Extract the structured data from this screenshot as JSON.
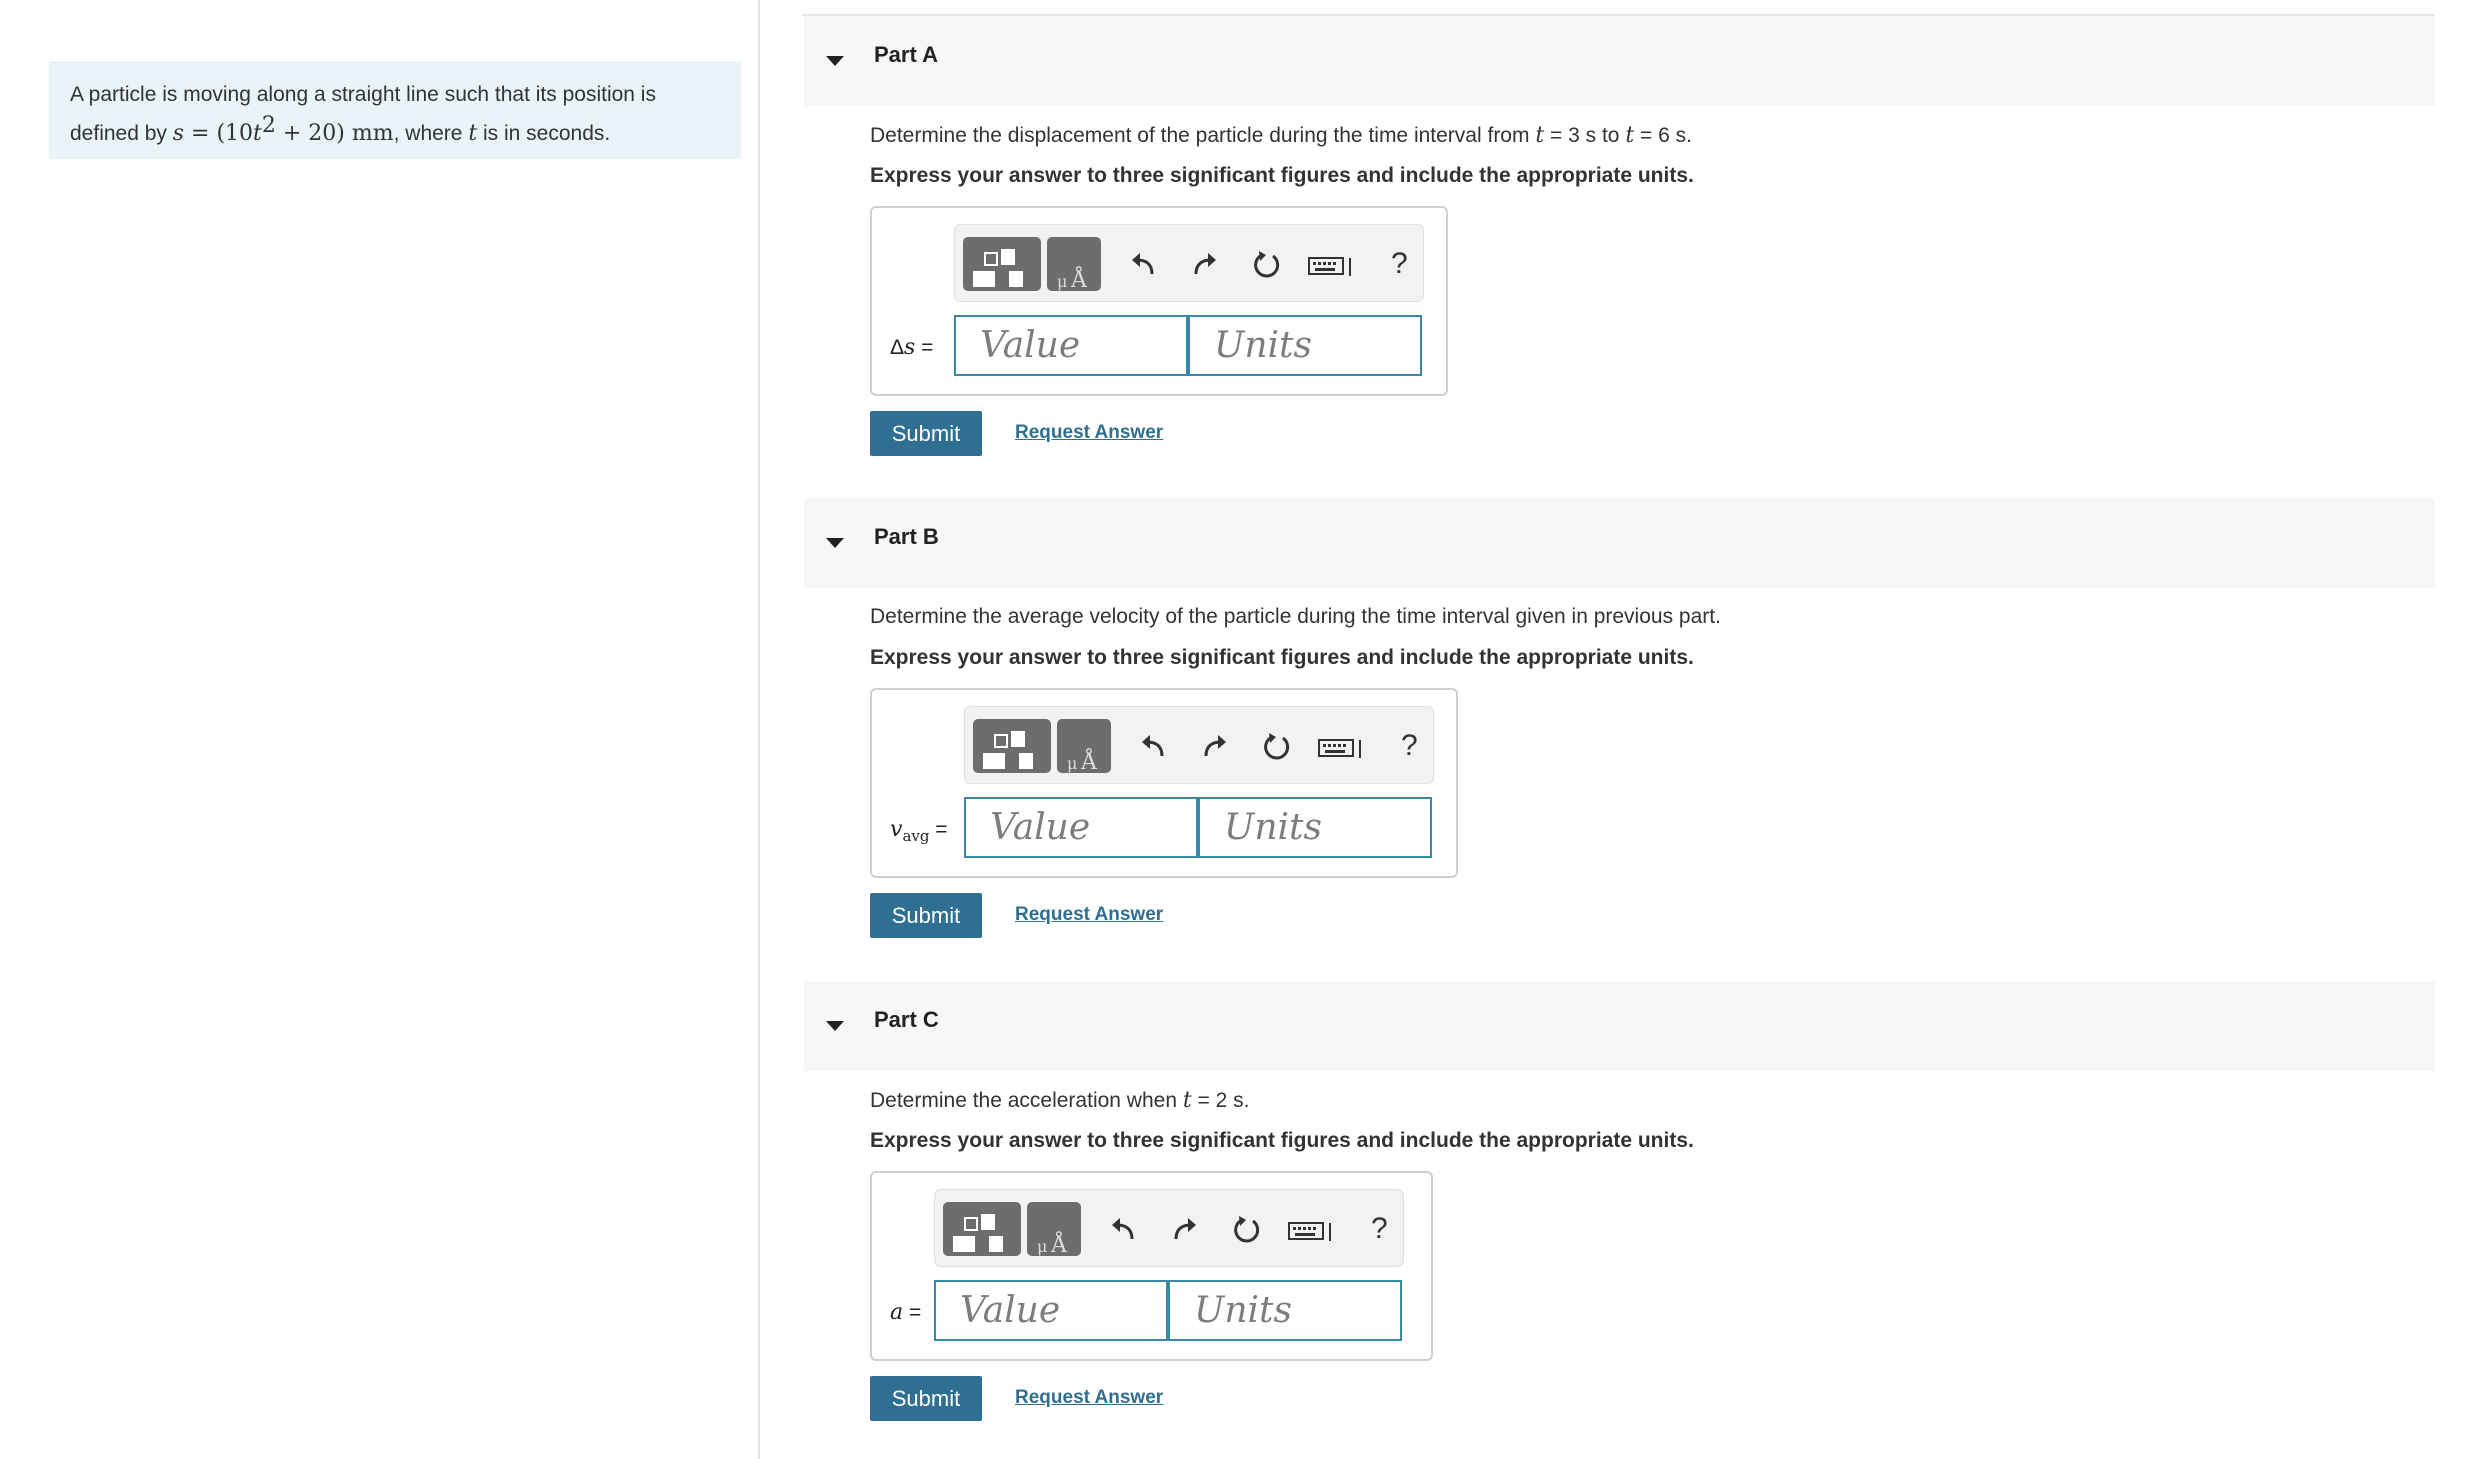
{
  "problem": {
    "text_before": "A particle is moving along a straight line such that its position is defined by ",
    "eq_s": "s",
    "eq_eq": " = (10",
    "eq_t": "t",
    "eq_exp": "2",
    "eq_rest": " + 20) mm",
    "text_after_eq": ", where ",
    "t": "t",
    "text_end": " is in seconds."
  },
  "toolbar": {
    "icons": [
      "templates-icon",
      "symbols-icon",
      "undo-icon",
      "redo-icon",
      "reset-icon",
      "keyboard-icon",
      "help-icon"
    ],
    "help_label": "?"
  },
  "placeholders": {
    "value": "Value",
    "units": "Units"
  },
  "parts": [
    {
      "title": "Part A",
      "question_pre": "Determine the displacement of the particle during the time interval from ",
      "t1": "t",
      "question_mid": " = 3 s to ",
      "t2": "t",
      "question_end": " = 6 s.",
      "instruction": "Express your answer to three significant figures and include the appropriate units.",
      "var_prefix": "Δ",
      "var": "s",
      "var_sub": "",
      "eq": " =",
      "submit_label": "Submit",
      "request_label": "Request Answer"
    },
    {
      "title": "Part B",
      "question": "Determine the average velocity of the particle during the time interval given in previous part.",
      "instruction": "Express your answer to three significant figures and include the appropriate units.",
      "var_prefix": "",
      "var": "v",
      "var_sub": "avg",
      "eq": " =",
      "submit_label": "Submit",
      "request_label": "Request Answer"
    },
    {
      "title": "Part C",
      "question_pre": "Determine the acceleration when ",
      "t1": "t",
      "question_end": " = 2 s.",
      "instruction": "Express your answer to three significant figures and include the appropriate units.",
      "var_prefix": "",
      "var": "a",
      "var_sub": "",
      "eq": " =",
      "submit_label": "Submit",
      "request_label": "Request Answer"
    }
  ],
  "colors": {
    "accent": "#2f6f91",
    "input_border": "#3b87a8",
    "problem_bg": "#e8f4f7",
    "header_bg": "#f7f7f7"
  }
}
